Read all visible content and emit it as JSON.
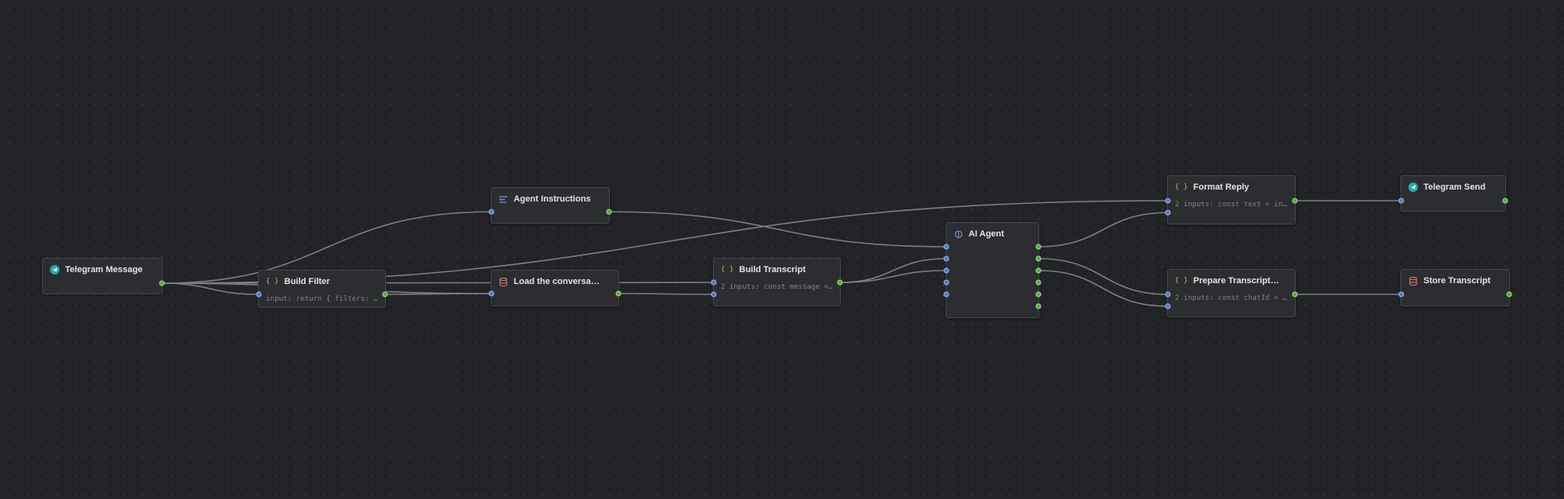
{
  "canvas": {
    "background": "#222326",
    "edge_color": "#7c7e84"
  },
  "nodes": [
    {
      "id": "telegram_message",
      "name": "telegram-message-node",
      "title": "Telegram Message",
      "icon": "telegram-icon",
      "body": ""
    },
    {
      "id": "build_filter",
      "name": "build-filter-node",
      "title": "Build Filter",
      "icon": "code-braces-icon",
      "body": "input: return { filters: …"
    },
    {
      "id": "agent_instructions",
      "name": "agent-instructions-node",
      "title": "Agent Instructions",
      "icon": "text-lines-icon",
      "body": ""
    },
    {
      "id": "load_conversation",
      "name": "load-conversation-node",
      "title": "Load the conversa…",
      "icon": "database-icon",
      "body": ""
    },
    {
      "id": "build_transcript",
      "name": "build-transcript-node",
      "title": "Build Transcript",
      "icon": "code-braces-icon",
      "body": "2 inputs: const message =…"
    },
    {
      "id": "ai_agent",
      "name": "ai-agent-node",
      "title": "AI Agent",
      "icon": "brain-icon",
      "body": ""
    },
    {
      "id": "format_reply",
      "name": "format-reply-node",
      "title": "Format Reply",
      "icon": "code-braces-icon",
      "body": "2 inputs: const text = in…"
    },
    {
      "id": "prepare_transcript",
      "name": "prepare-transcript-node",
      "title": "Prepare Transcript…",
      "icon": "code-braces-icon",
      "body": "2 inputs: const chatId = …"
    },
    {
      "id": "telegram_send",
      "name": "telegram-send-node",
      "title": "Telegram Send",
      "icon": "telegram-icon",
      "body": ""
    },
    {
      "id": "store_transcript",
      "name": "store-transcript-node",
      "title": "Store Transcript",
      "icon": "database-icon",
      "body": ""
    }
  ],
  "connections": [
    [
      "telegram_message",
      "agent_instructions"
    ],
    [
      "telegram_message",
      "format_reply"
    ],
    [
      "telegram_message",
      "build_filter"
    ],
    [
      "telegram_message",
      "load_conversation"
    ],
    [
      "telegram_message",
      "build_transcript"
    ],
    [
      "build_filter",
      "load_conversation"
    ],
    [
      "agent_instructions",
      "ai_agent"
    ],
    [
      "load_conversation",
      "build_transcript"
    ],
    [
      "build_transcript",
      "ai_agent"
    ],
    [
      "build_transcript",
      "ai_agent"
    ],
    [
      "ai_agent",
      "format_reply"
    ],
    [
      "ai_agent",
      "prepare_transcript"
    ],
    [
      "ai_agent",
      "prepare_transcript"
    ],
    [
      "format_reply",
      "telegram_send"
    ],
    [
      "prepare_transcript",
      "store_transcript"
    ]
  ]
}
